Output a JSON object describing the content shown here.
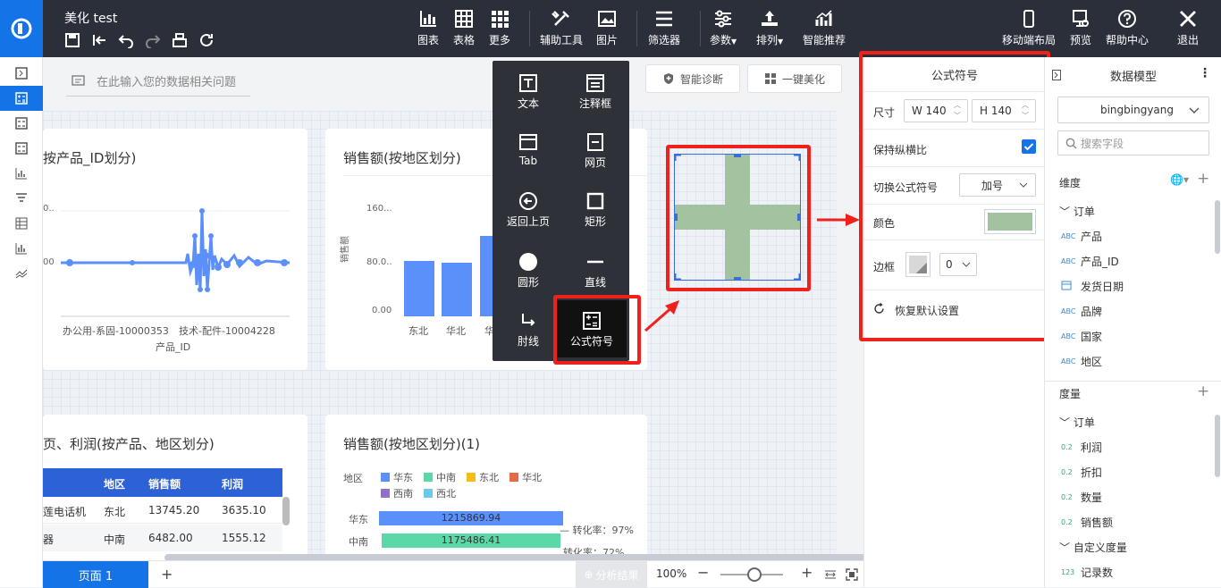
{
  "app": {
    "title": "美化 test"
  },
  "toolbar": {
    "chart": "图表",
    "table": "表格",
    "more": "更多",
    "assist": "辅助工具",
    "image": "图片",
    "filter": "筛选器",
    "params": "参数",
    "sort": "排列",
    "smart": "智能推荐",
    "mobile": "移动端布局",
    "preview": "预览",
    "help": "帮助中心",
    "exit": "退出"
  },
  "search": {
    "placeholder": "在此输入您的数据相关问题"
  },
  "actions": {
    "diagnose": "智能诊断",
    "beautify": "一键美化"
  },
  "popup": {
    "items": [
      "文本",
      "注释框",
      "Tab",
      "网页",
      "返回上页",
      "矩形",
      "圆形",
      "直线",
      "肘线",
      "公式符号"
    ]
  },
  "cards": {
    "c1": {
      "title": "按产品_ID划分)",
      "xticks": [
        "办公用-系固-10000353",
        "技术-配件-10004228"
      ],
      "xlabel": "产品_ID",
      "ytick0": "0..",
      "ytick1": "00"
    },
    "c2": {
      "title": "销售额(按地区划分)",
      "ylabel": "销售额",
      "yticks": [
        "160...",
        "80.0..",
        "0.00"
      ],
      "xticks": [
        "东北",
        "华北",
        "华"
      ]
    },
    "c3": {
      "title": "页、利润(按产品、地区划分)",
      "headers": [
        "地区",
        "销售额",
        "利润"
      ],
      "rows": [
        {
          "prod": "莲电话机",
          "region": "东北",
          "sales": "13745.20",
          "profit": "3635.10"
        },
        {
          "prod": "器",
          "region": "中南",
          "sales": "6482.00",
          "profit": "1555.12"
        }
      ]
    },
    "c4": {
      "title": "销售额(按地区划分)(1)",
      "legend_title": "地区",
      "legend": [
        "华东",
        "中南",
        "东北",
        "华北",
        "西南",
        "西北"
      ],
      "bars": [
        {
          "label": "华东",
          "value": "1215869.94"
        },
        {
          "label": "中南",
          "value": "1175486.41"
        }
      ],
      "rate1": "转化率：97%",
      "rate2": "转化率：72%"
    }
  },
  "colors": {
    "legend": [
      "#5b8ff9",
      "#5ad8a6",
      "#f6bd16",
      "#e8684a",
      "#9270ca",
      "#6dc8ec"
    ],
    "shape": "#a3c3a0",
    "accent": "#1473e6"
  },
  "formula": {
    "title": "公式符号",
    "size_label": "尺寸",
    "w": "W 140",
    "h": "H 140",
    "keep_ratio": "保持纵横比",
    "switch_label": "切换公式符号",
    "symbol": "加号",
    "color_label": "颜色",
    "border_label": "边框",
    "border_value": "0",
    "reset": "恢复默认设置"
  },
  "model": {
    "title": "数据模型",
    "dataset": "bingbingyang",
    "search_placeholder": "搜索字段",
    "dimension": "维度",
    "order": "订单",
    "dims": [
      {
        "tag": "ABC",
        "name": "产品"
      },
      {
        "tag": "ABC",
        "name": "产品_ID"
      },
      {
        "tag": "date",
        "name": "发货日期"
      },
      {
        "tag": "ABC",
        "name": "品牌"
      },
      {
        "tag": "ABC",
        "name": "国家"
      },
      {
        "tag": "ABC",
        "name": "地区"
      }
    ],
    "measure": "度量",
    "measures": [
      {
        "tag": "0.2",
        "name": "利润"
      },
      {
        "tag": "0.2",
        "name": "折扣"
      },
      {
        "tag": "0.2",
        "name": "数量"
      },
      {
        "tag": "0.2",
        "name": "销售额"
      }
    ],
    "custom": "自定义度量",
    "custom_items": [
      {
        "tag": "123",
        "name": "记录数"
      }
    ]
  },
  "bottom": {
    "page": "页面 1",
    "add": "+",
    "analysis": "分析结果",
    "zoom": "100%"
  }
}
